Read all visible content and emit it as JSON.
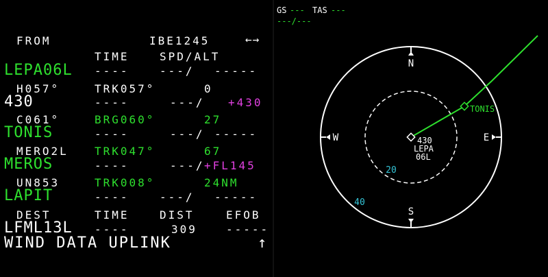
{
  "mcdu": {
    "header": {
      "from_label": "FROM",
      "flight_id": "IBE1245",
      "arrows": "←→"
    },
    "col_headers": {
      "time": "TIME",
      "spd_alt": "SPD/ALT"
    },
    "rows": [
      {
        "waypoint": "LEPA06L",
        "time": "----",
        "speed": "---/",
        "alt": "-----"
      },
      {
        "leg": "H057°",
        "track": "TRK057°",
        "dist": "0"
      },
      {
        "waypoint": "430",
        "time": "----",
        "speed": "---/",
        "alt": "+430"
      },
      {
        "leg": "C061°",
        "track": "BRG060°",
        "dist": "27"
      },
      {
        "waypoint": "TONIS",
        "time": "----",
        "speed": "---/",
        "alt": "-----"
      },
      {
        "leg": "MERO2L",
        "track": "TRK047°",
        "dist": "67"
      },
      {
        "waypoint": "MEROS",
        "time": "----",
        "speed": "---/",
        "alt": "+FL145"
      },
      {
        "leg": "UN853",
        "track": "TRK008°",
        "dist": "24NM"
      },
      {
        "waypoint": "LAPIT",
        "time": "----",
        "speed": "---/",
        "alt": "-----"
      }
    ],
    "dest_headers": {
      "dest": "DEST",
      "time": "TIME",
      "dist": "DIST",
      "efob": "EFOB"
    },
    "dest_row": {
      "airport": "LFML13L",
      "time": "----",
      "dist": "309",
      "efob": "-----"
    },
    "scratchpad": "WIND DATA UPLINK",
    "scroll_arrow": "↑"
  },
  "nd": {
    "gs_label": "GS",
    "gs_value": "---",
    "tas_label": "TAS",
    "tas_value": "---",
    "wind": "---/---",
    "compass": {
      "n": "N",
      "e": "E",
      "s": "S",
      "w": "W"
    },
    "range_inner": "20",
    "range_outer": "40",
    "waypoint_label": "TONIS",
    "aircraft_alt": "430",
    "airport": "LEPA",
    "runway": "06L",
    "colors": {
      "route": "#2ee02e",
      "range": "#35c6d8",
      "magenta": "#e040e0"
    }
  }
}
